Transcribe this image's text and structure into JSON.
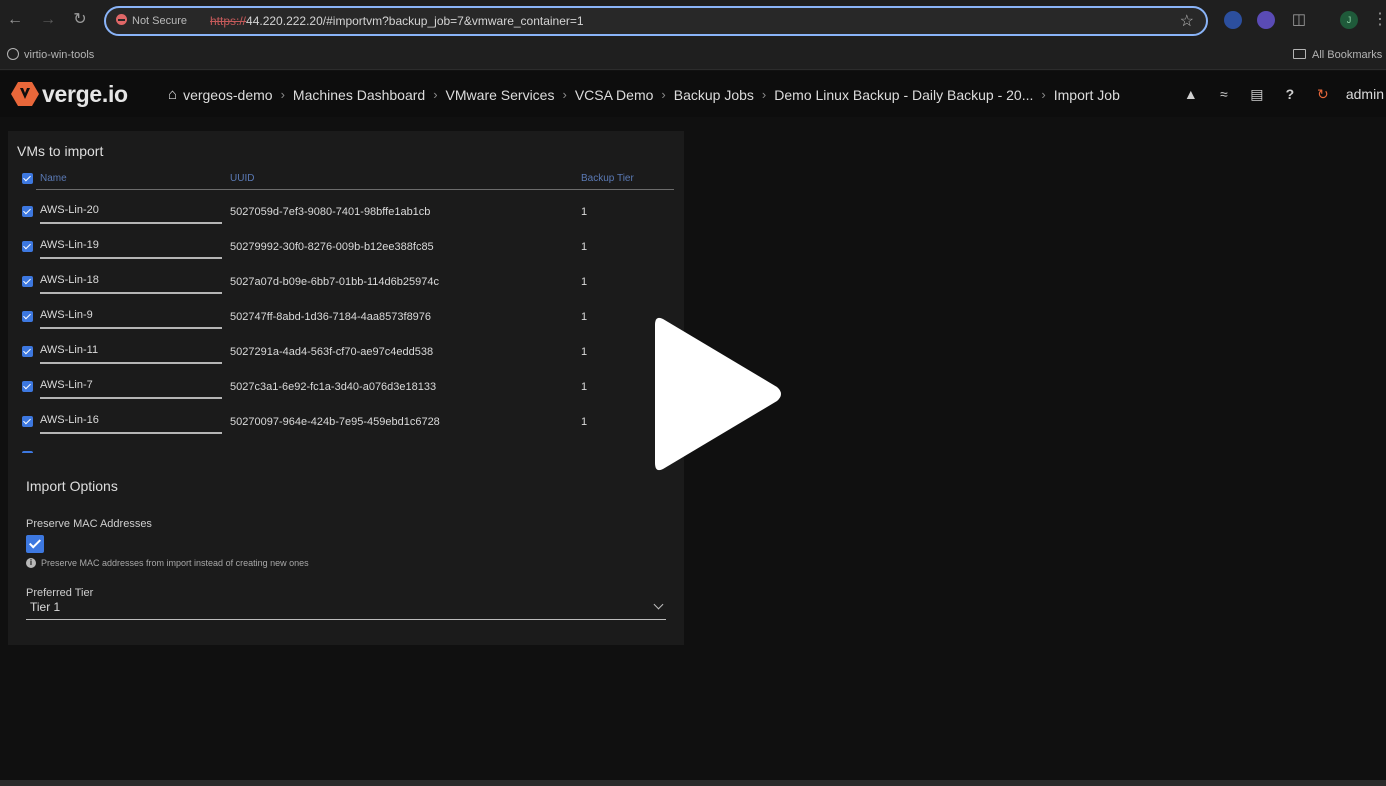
{
  "browser": {
    "security_label": "Not Secure",
    "url_scheme": "https://",
    "url_rest": "44.220.222.20/#importvm?backup_job=7&vmware_container=1",
    "bookmarks": {
      "left": "virtio-win-tools",
      "right": "All Bookmarks"
    },
    "profile_initial": "J"
  },
  "header": {
    "logo_text": "verge.io",
    "breadcrumbs": [
      "vergeos-demo",
      "Machines Dashboard",
      "VMware Services",
      "VCSA Demo",
      "Backup Jobs",
      "Demo Linux Backup - Daily Backup - 20...",
      "Import Job"
    ],
    "user": "admin"
  },
  "vm_panel": {
    "title": "VMs to import",
    "columns": {
      "name": "Name",
      "uuid": "UUID",
      "tier": "Backup Tier"
    },
    "rows": [
      {
        "name": "AWS-Lin-20",
        "uuid": "5027059d-7ef3-9080-7401-98bffe1ab1cb",
        "tier": "1"
      },
      {
        "name": "AWS-Lin-19",
        "uuid": "50279992-30f0-8276-009b-b12ee388fc85",
        "tier": "1"
      },
      {
        "name": "AWS-Lin-18",
        "uuid": "5027a07d-b09e-6bb7-01bb-114d6b25974c",
        "tier": "1"
      },
      {
        "name": "AWS-Lin-9",
        "uuid": "502747ff-8abd-1d36-7184-4aa8573f8976",
        "tier": "1"
      },
      {
        "name": "AWS-Lin-11",
        "uuid": "5027291a-4ad4-563f-cf70-ae97c4edd538",
        "tier": "1"
      },
      {
        "name": "AWS-Lin-7",
        "uuid": "5027c3a1-6e92-fc1a-3d40-a076d3e18133",
        "tier": "1"
      },
      {
        "name": "AWS-Lin-16",
        "uuid": "50270097-964e-424b-7e95-459ebd1c6728",
        "tier": "1"
      }
    ]
  },
  "import_options": {
    "title": "Import Options",
    "preserve_mac_label": "Preserve MAC Addresses",
    "preserve_mac_checked": true,
    "preserve_mac_hint": "Preserve MAC addresses from import instead of creating new ones",
    "tier_label": "Preferred Tier",
    "tier_value": "Tier 1"
  },
  "colors": {
    "accent": "#3d78e0",
    "logo_orange": "#e8673a",
    "background": "#101010"
  }
}
